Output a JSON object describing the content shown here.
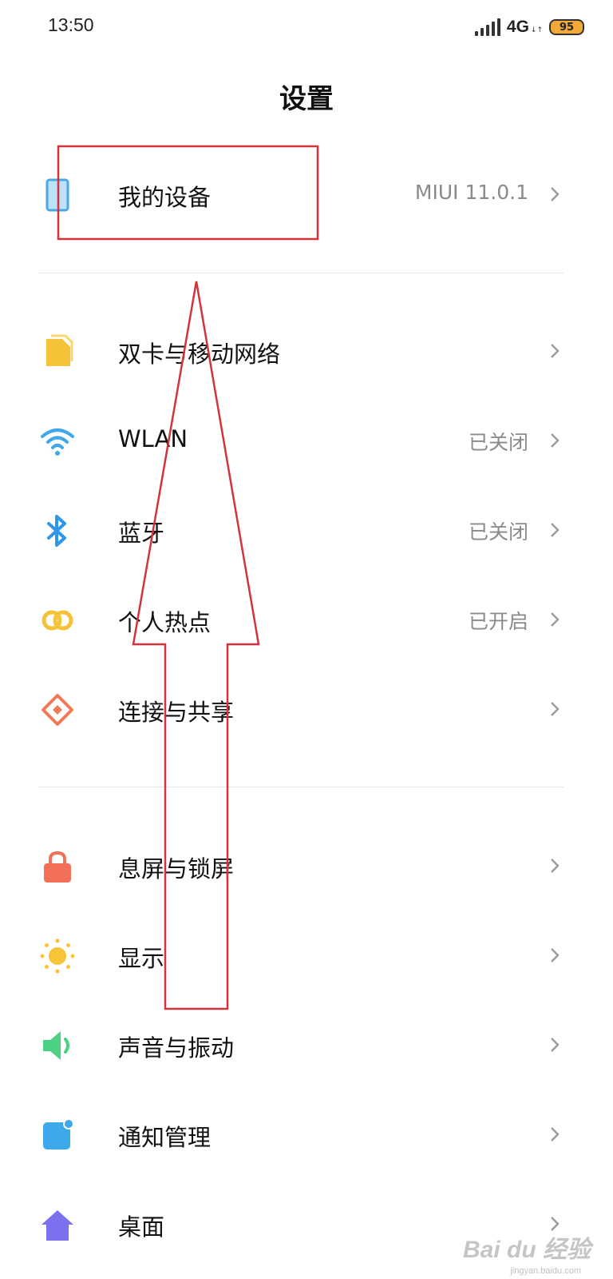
{
  "status_bar": {
    "time": "13:50",
    "network": "4G",
    "battery": "95"
  },
  "header": {
    "title": "设置"
  },
  "settings": [
    {
      "label": "我的设备",
      "value": "MIUI 11.0.1",
      "icon": "phone-icon",
      "color": "#4aa8e8"
    },
    {
      "label": "双卡与移动网络",
      "value": "",
      "icon": "sim-card-icon",
      "color": "#f6c338"
    },
    {
      "label": "WLAN",
      "value": "已关闭",
      "icon": "wifi-icon",
      "color": "#3ea9ea"
    },
    {
      "label": "蓝牙",
      "value": "已关闭",
      "icon": "bluetooth-icon",
      "color": "#2f96e8"
    },
    {
      "label": "个人热点",
      "value": "已开启",
      "icon": "hotspot-icon",
      "color": "#f6c338"
    },
    {
      "label": "连接与共享",
      "value": "",
      "icon": "share-icon",
      "color": "#ef7a5a"
    },
    {
      "label": "息屏与锁屏",
      "value": "",
      "icon": "lock-icon",
      "color": "#f2705a"
    },
    {
      "label": "显示",
      "value": "",
      "icon": "sun-icon",
      "color": "#f8c437"
    },
    {
      "label": "声音与振动",
      "value": "",
      "icon": "speaker-icon",
      "color": "#4cd083"
    },
    {
      "label": "通知管理",
      "value": "",
      "icon": "notification-icon",
      "color": "#3ea9ea"
    },
    {
      "label": "桌面",
      "value": "",
      "icon": "home-icon",
      "color": "#7b71ee"
    }
  ],
  "watermark": {
    "brand": "Bai du 经验",
    "site": "jingyan.baidu.com"
  },
  "colors": {
    "annotation": "#d3343c",
    "value_text": "#8a8a8a",
    "divider": "#e6e6e6"
  }
}
